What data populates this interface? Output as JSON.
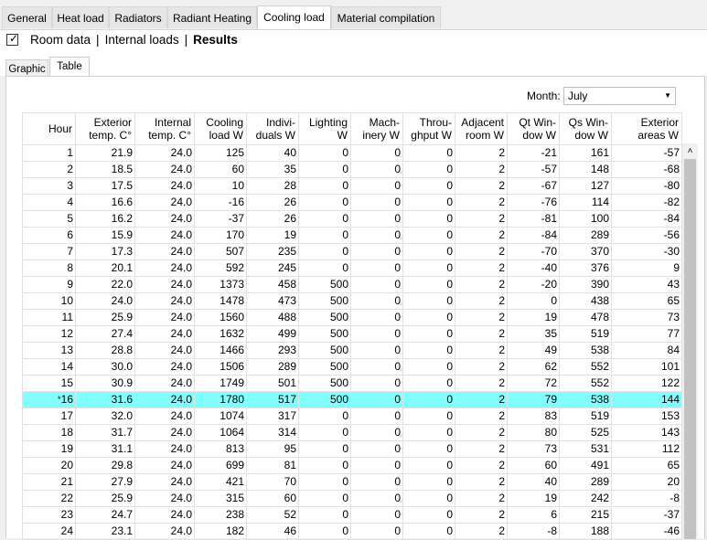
{
  "top_tabs": [
    "General",
    "Heat load",
    "Radiators",
    "Radiant Heating",
    "Cooling load",
    "Material compilation"
  ],
  "active_top_tab": "Cooling load",
  "subnav": {
    "checked": true,
    "room_data": "Room data",
    "separator": "|",
    "internal_loads": "Internal loads",
    "results": "Results"
  },
  "inner_tabs": {
    "graphic": "Graphic",
    "table": "Table",
    "active": "Table"
  },
  "month": {
    "label": "Month:",
    "value": "July"
  },
  "table": {
    "headers": [
      [
        "Hour"
      ],
      [
        "Exterior",
        "temp. C°"
      ],
      [
        "Internal",
        "temp. C°"
      ],
      [
        "Cooling",
        "load W"
      ],
      [
        "Indivi-",
        "duals W"
      ],
      [
        "Lighting",
        "W"
      ],
      [
        "Mach-",
        "inery W"
      ],
      [
        "Throu-",
        "ghput W"
      ],
      [
        "Adjacent",
        "room W"
      ],
      [
        "Qt Win-",
        "dow W"
      ],
      [
        "Qs Win-",
        "dow W"
      ],
      [
        "Exterior",
        "areas W"
      ]
    ],
    "highlight_row_index": 15,
    "highlight_marker": "*",
    "rows": [
      [
        "1",
        "21.9",
        "24.0",
        "125",
        "40",
        "0",
        "0",
        "0",
        "2",
        "-21",
        "161",
        "-57"
      ],
      [
        "2",
        "18.5",
        "24.0",
        "60",
        "35",
        "0",
        "0",
        "0",
        "2",
        "-57",
        "148",
        "-68"
      ],
      [
        "3",
        "17.5",
        "24.0",
        "10",
        "28",
        "0",
        "0",
        "0",
        "2",
        "-67",
        "127",
        "-80"
      ],
      [
        "4",
        "16.6",
        "24.0",
        "-16",
        "26",
        "0",
        "0",
        "0",
        "2",
        "-76",
        "114",
        "-82"
      ],
      [
        "5",
        "16.2",
        "24.0",
        "-37",
        "26",
        "0",
        "0",
        "0",
        "2",
        "-81",
        "100",
        "-84"
      ],
      [
        "6",
        "15.9",
        "24.0",
        "170",
        "19",
        "0",
        "0",
        "0",
        "2",
        "-84",
        "289",
        "-56"
      ],
      [
        "7",
        "17.3",
        "24.0",
        "507",
        "235",
        "0",
        "0",
        "0",
        "2",
        "-70",
        "370",
        "-30"
      ],
      [
        "8",
        "20.1",
        "24.0",
        "592",
        "245",
        "0",
        "0",
        "0",
        "2",
        "-40",
        "376",
        "9"
      ],
      [
        "9",
        "22.0",
        "24.0",
        "1373",
        "458",
        "500",
        "0",
        "0",
        "2",
        "-20",
        "390",
        "43"
      ],
      [
        "10",
        "24.0",
        "24.0",
        "1478",
        "473",
        "500",
        "0",
        "0",
        "2",
        "0",
        "438",
        "65"
      ],
      [
        "11",
        "25.9",
        "24.0",
        "1560",
        "488",
        "500",
        "0",
        "0",
        "2",
        "19",
        "478",
        "73"
      ],
      [
        "12",
        "27.4",
        "24.0",
        "1632",
        "499",
        "500",
        "0",
        "0",
        "2",
        "35",
        "519",
        "77"
      ],
      [
        "13",
        "28.8",
        "24.0",
        "1466",
        "293",
        "500",
        "0",
        "0",
        "2",
        "49",
        "538",
        "84"
      ],
      [
        "14",
        "30.0",
        "24.0",
        "1506",
        "289",
        "500",
        "0",
        "0",
        "2",
        "62",
        "552",
        "101"
      ],
      [
        "15",
        "30.9",
        "24.0",
        "1749",
        "501",
        "500",
        "0",
        "0",
        "2",
        "72",
        "552",
        "122"
      ],
      [
        "16",
        "31.6",
        "24.0",
        "1780",
        "517",
        "500",
        "0",
        "0",
        "2",
        "79",
        "538",
        "144"
      ],
      [
        "17",
        "32.0",
        "24.0",
        "1074",
        "317",
        "0",
        "0",
        "0",
        "2",
        "83",
        "519",
        "153"
      ],
      [
        "18",
        "31.7",
        "24.0",
        "1064",
        "314",
        "0",
        "0",
        "0",
        "2",
        "80",
        "525",
        "143"
      ],
      [
        "19",
        "31.1",
        "24.0",
        "813",
        "95",
        "0",
        "0",
        "0",
        "2",
        "73",
        "531",
        "112"
      ],
      [
        "20",
        "29.8",
        "24.0",
        "699",
        "81",
        "0",
        "0",
        "0",
        "2",
        "60",
        "491",
        "65"
      ],
      [
        "21",
        "27.9",
        "24.0",
        "421",
        "70",
        "0",
        "0",
        "0",
        "2",
        "40",
        "289",
        "20"
      ],
      [
        "22",
        "25.9",
        "24.0",
        "315",
        "60",
        "0",
        "0",
        "0",
        "2",
        "19",
        "242",
        "-8"
      ],
      [
        "23",
        "24.7",
        "24.0",
        "238",
        "52",
        "0",
        "0",
        "0",
        "2",
        "6",
        "215",
        "-37"
      ],
      [
        "24",
        "23.1",
        "24.0",
        "182",
        "46",
        "0",
        "0",
        "0",
        "2",
        "-8",
        "188",
        "-46"
      ]
    ]
  },
  "icons": {
    "checkmark": "checkmark-icon",
    "dropdown": "chevron-down-icon",
    "scroll_up": "chevron-up-icon"
  },
  "colors": {
    "highlight": "#80ffff"
  }
}
